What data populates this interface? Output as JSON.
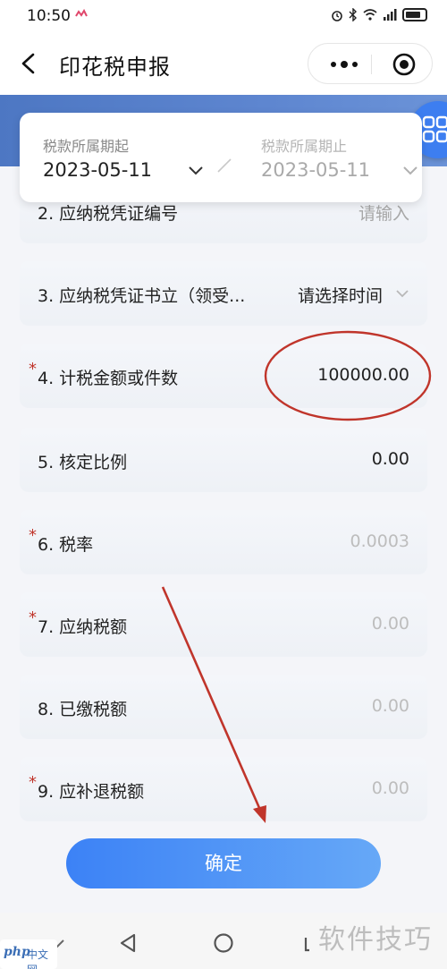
{
  "status_bar": {
    "time": "10:50",
    "icons": [
      "alarm-icon",
      "bluetooth-icon",
      "wifi-icon",
      "signal-icon",
      "battery-icon"
    ]
  },
  "nav": {
    "back_icon": "chevron-left-icon",
    "title": "印花税申报",
    "more_icon": "more-dots-icon",
    "target_icon": "target-icon"
  },
  "period": {
    "start_label": "税款所属期起",
    "start_value": "2023-05-11",
    "end_label": "税款所属期止",
    "end_value": "2023-05-11"
  },
  "form": {
    "rows": [
      {
        "label": "2. 应纳税凭证编号",
        "value": "请输入",
        "required": false
      },
      {
        "label": "3. 应纳税凭证书立（领受...",
        "value": "请选择时间",
        "required": false
      },
      {
        "label": "4. 计税金额或件数",
        "value": "100000.00",
        "required": true
      },
      {
        "label": "5. 核定比例",
        "value": "0.00",
        "required": false
      },
      {
        "label": "6. 税率",
        "value": "0.0003",
        "required": true
      },
      {
        "label": "7. 应纳税额",
        "value": "0.00",
        "required": true
      },
      {
        "label": "8. 已缴税额",
        "value": "0.00",
        "required": false
      },
      {
        "label": "9. 应补退税额",
        "value": "0.00",
        "required": true
      }
    ],
    "required_mark": "*"
  },
  "confirm_label": "确定",
  "watermark": {
    "logo_php": "php",
    "logo_cn": "中文网",
    "text": "软件技巧"
  },
  "colors": {
    "accent": "#3d7ef0",
    "header_band": "#5e86d0",
    "required": "#c0352b",
    "annotation": "#c0352b"
  }
}
